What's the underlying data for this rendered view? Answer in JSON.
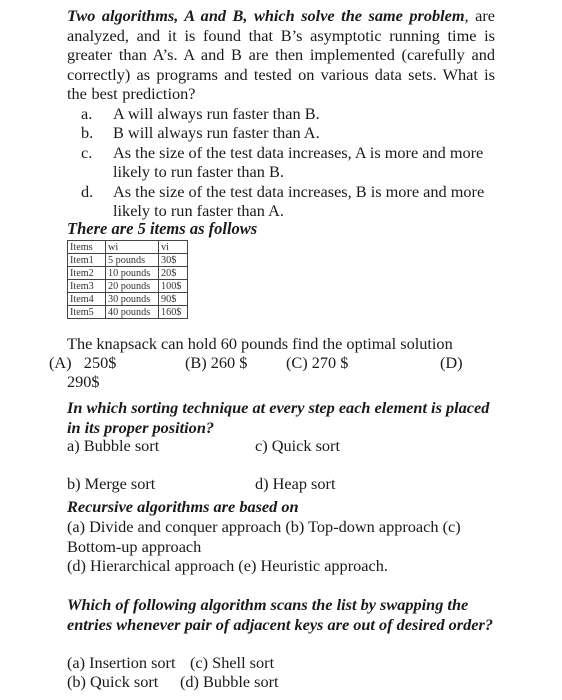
{
  "question1": {
    "bold_lead": "Two algorithms, A and B, which solve the same problem",
    "body": ", are analyzed, and it is found that B’s asymptotic running time is greater than A’s. A and B are then implemented (carefully and correctly) as programs and tested on various data sets. What is the best prediction?",
    "options": [
      {
        "label": "a.",
        "text": "A will always run faster than B."
      },
      {
        "label": "b.",
        "text": "B will always run faster than A."
      },
      {
        "label": "c.",
        "text": "As the size of the test data increases, A is more and more likely to run faster than B."
      },
      {
        "label": "d.",
        "text": "As the size of the test data increases, B is more and more likely to run faster than A."
      }
    ]
  },
  "question2": {
    "title": "There are 5 items as follows",
    "table": {
      "headers": [
        "Items",
        "wi",
        "vi"
      ],
      "rows": [
        [
          "Item1",
          "5 pounds",
          "30$"
        ],
        [
          "Item2",
          "10 pounds",
          "20$"
        ],
        [
          "Item3",
          "20 pounds",
          "100$"
        ],
        [
          "Item4",
          "30 pounds",
          "90$"
        ],
        [
          "Item5",
          "40 pounds",
          "160$"
        ]
      ]
    },
    "prompt": "The knapsack can hold 60 pounds find the optimal solution",
    "options": {
      "a": "(A)   250$",
      "b": "(B) 260 $",
      "c": "(C) 270 $",
      "d_label": "(D)",
      "d_value": "290$"
    }
  },
  "question3": {
    "prompt": "In which sorting technique at every step each element is placed in its proper position?",
    "options": {
      "a": "a) Bubble sort",
      "b": "b) Merge sort",
      "c": "c) Quick sort",
      "d": "d) Heap sort"
    }
  },
  "question4": {
    "prompt": "Recursive algorithms are based on",
    "line1": "(a) Divide and conquer approach (b) Top-down approach (c)",
    "line2": "Bottom-up approach",
    "line3": "(d) Hierarchical approach (e) Heuristic approach."
  },
  "question5": {
    "prompt": "Which of following algorithm scans the list by swapping the entries whenever pair of adjacent keys are out of desired order?",
    "options": {
      "a": "(a) Insertion sort",
      "b": "(b) Quick sort",
      "c": "(c) Shell sort",
      "d": "(d) Bubble sort"
    }
  }
}
